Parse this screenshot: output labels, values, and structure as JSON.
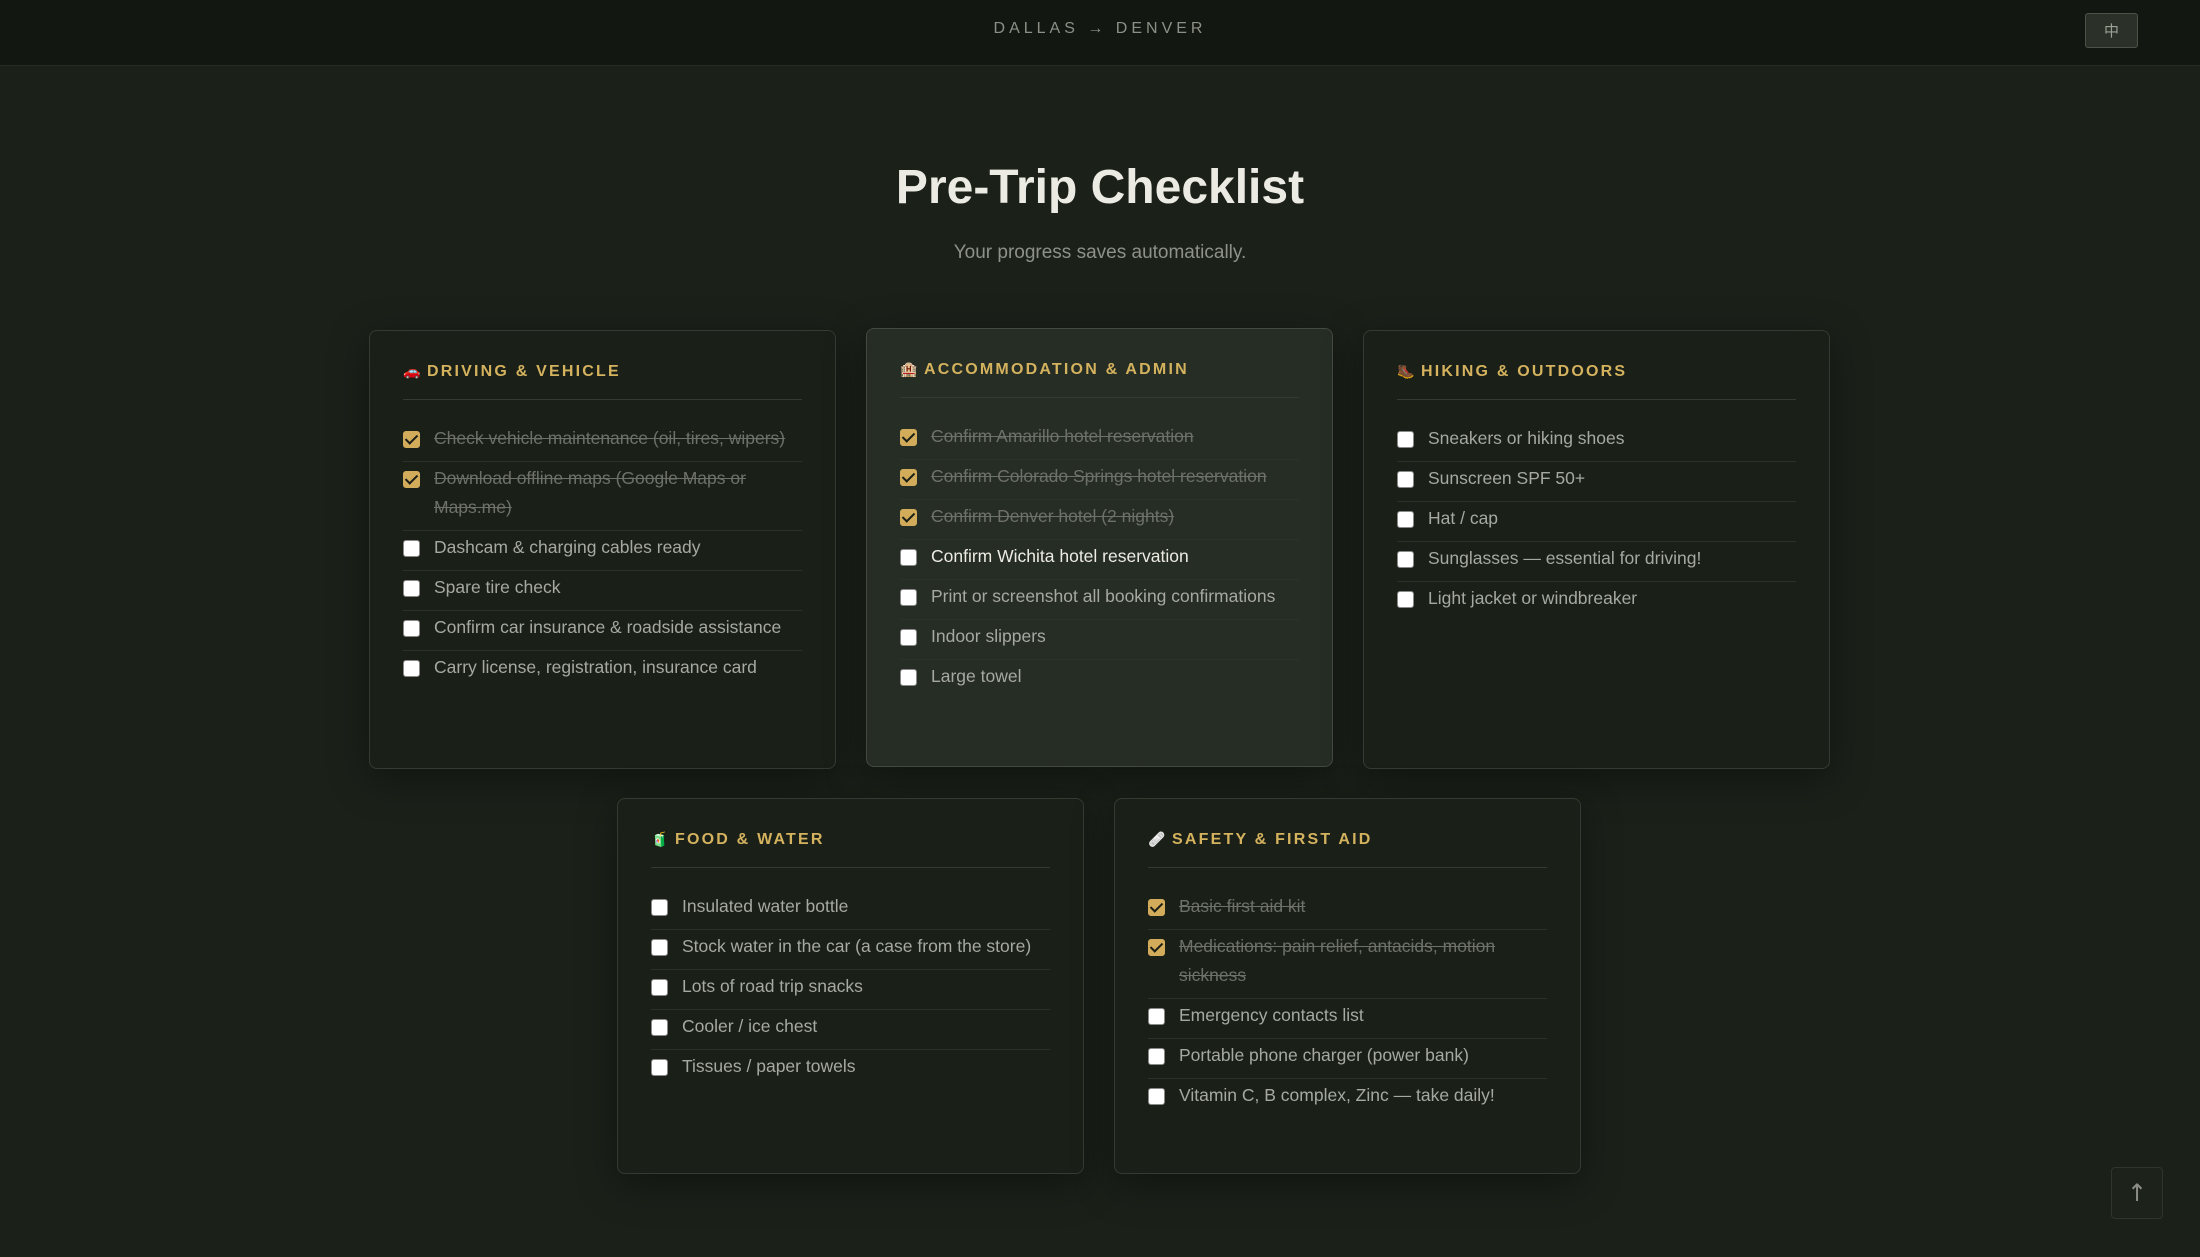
{
  "header": {
    "route": "DALLAS → DENVER",
    "lang_label": "中"
  },
  "page": {
    "title": "Pre-Trip Checklist",
    "subtitle": "Your progress saves automatically."
  },
  "colors": {
    "accent": "#d4b25e",
    "background": "#1b2019",
    "card": "#1a1f18"
  },
  "cards": [
    {
      "icon": "🚗",
      "icon_name": "car-icon",
      "title": "DRIVING & VEHICLE",
      "items": [
        {
          "label": "Check vehicle maintenance (oil, tires, wipers)",
          "checked": true
        },
        {
          "label": "Download offline maps (Google Maps or Maps.me)",
          "checked": true
        },
        {
          "label": "Dashcam & charging cables ready",
          "checked": false
        },
        {
          "label": "Spare tire check",
          "checked": false
        },
        {
          "label": "Confirm car insurance & roadside assistance",
          "checked": false
        },
        {
          "label": "Carry license, registration, insurance card",
          "checked": false
        }
      ]
    },
    {
      "icon": "🏨",
      "icon_name": "hotel-icon",
      "title": "ACCOMMODATION & ADMIN",
      "items": [
        {
          "label": "Confirm Amarillo hotel reservation",
          "checked": true
        },
        {
          "label": "Confirm Colorado Springs hotel reservation",
          "checked": true
        },
        {
          "label": "Confirm Denver hotel (2 nights)",
          "checked": true
        },
        {
          "label": "Confirm Wichita hotel reservation",
          "checked": false
        },
        {
          "label": "Print or screenshot all booking confirmations",
          "checked": false
        },
        {
          "label": "Indoor slippers",
          "checked": false
        },
        {
          "label": "Large towel",
          "checked": false
        }
      ]
    },
    {
      "icon": "🥾",
      "icon_name": "hiking-boot-icon",
      "title": "HIKING & OUTDOORS",
      "items": [
        {
          "label": "Sneakers or hiking shoes",
          "checked": false
        },
        {
          "label": "Sunscreen SPF 50+",
          "checked": false
        },
        {
          "label": "Hat / cap",
          "checked": false
        },
        {
          "label": "Sunglasses — essential for driving!",
          "checked": false
        },
        {
          "label": "Light jacket or windbreaker",
          "checked": false
        }
      ]
    },
    {
      "icon": "🧃",
      "icon_name": "drink-icon",
      "title": "FOOD & WATER",
      "items": [
        {
          "label": "Insulated water bottle",
          "checked": false
        },
        {
          "label": "Stock water in the car (a case from the store)",
          "checked": false
        },
        {
          "label": "Lots of road trip snacks",
          "checked": false
        },
        {
          "label": "Cooler / ice chest",
          "checked": false
        },
        {
          "label": "Tissues / paper towels",
          "checked": false
        }
      ]
    },
    {
      "icon": "🩹",
      "icon_name": "bandage-icon",
      "title": "SAFETY & FIRST AID",
      "items": [
        {
          "label": "Basic first aid kit",
          "checked": true
        },
        {
          "label": "Medications: pain relief, antacids, motion sickness",
          "checked": true
        },
        {
          "label": "Emergency contacts list",
          "checked": false
        },
        {
          "label": "Portable phone charger (power bank)",
          "checked": false
        },
        {
          "label": "Vitamin C, B complex, Zinc — take daily!",
          "checked": false
        }
      ]
    }
  ],
  "scroll_top_label": "↑"
}
